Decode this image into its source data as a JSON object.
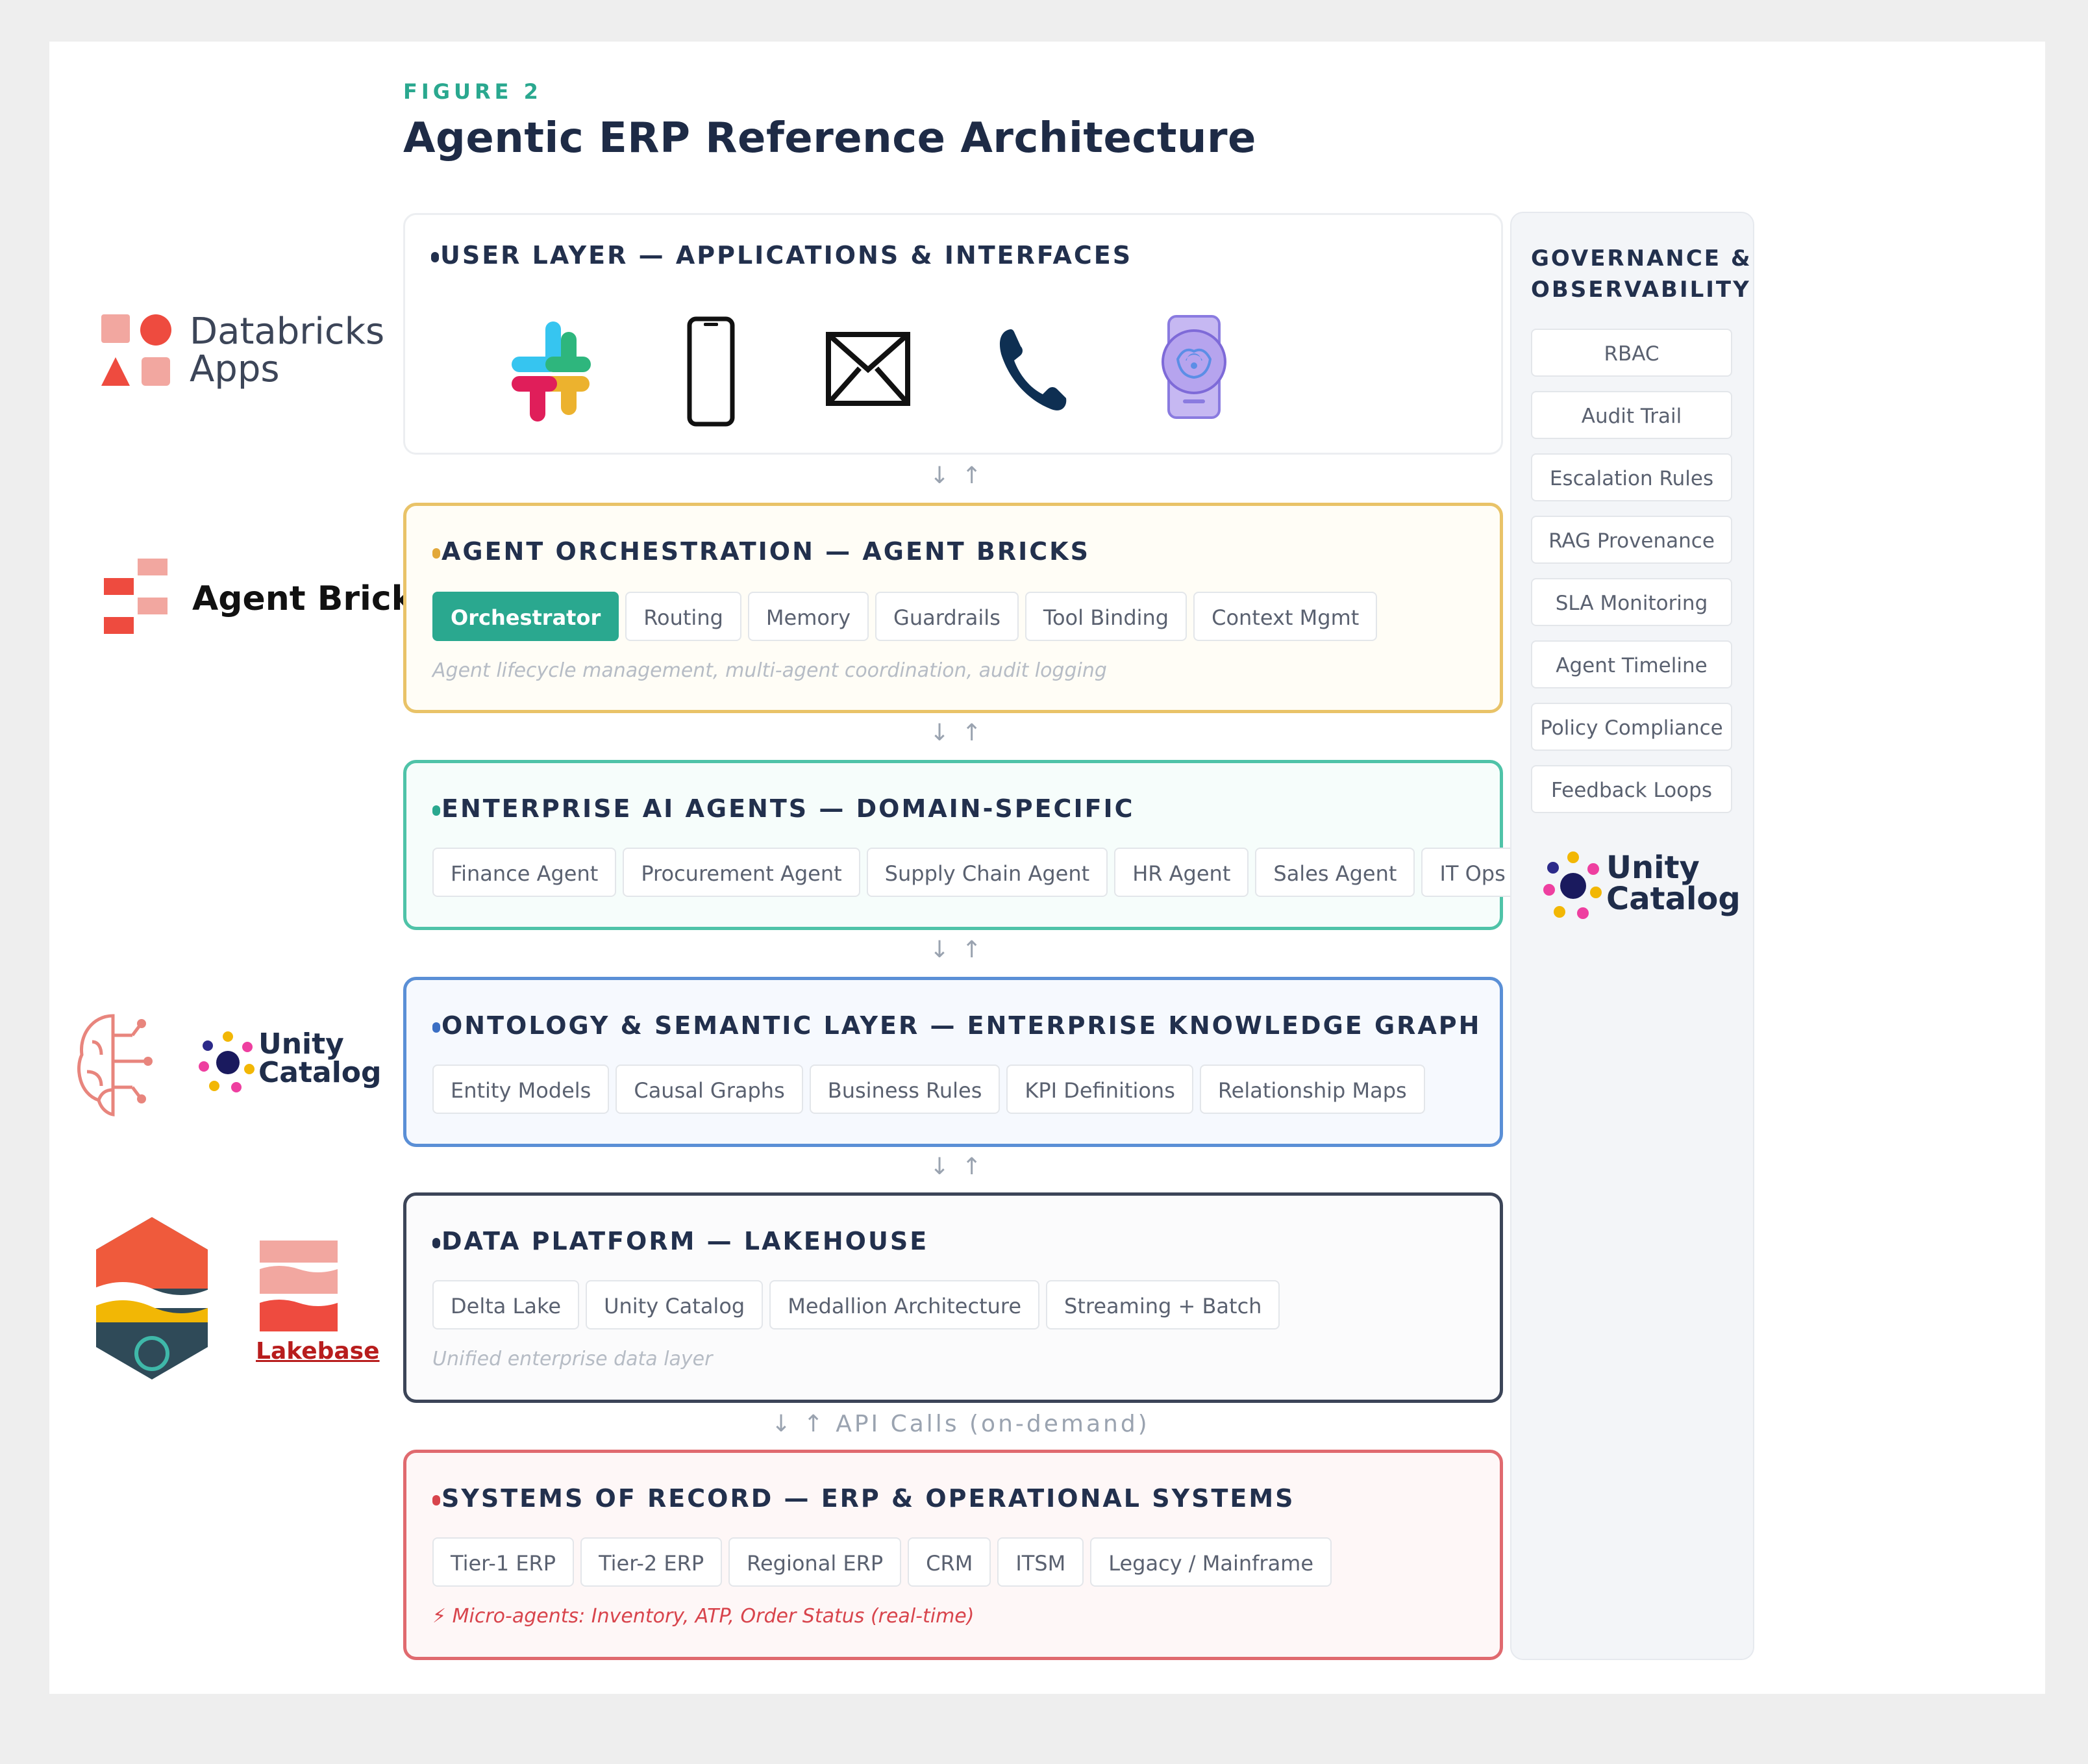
{
  "figure_label": "FIGURE 2",
  "title": "Agentic ERP Reference Architecture",
  "layers": {
    "user": {
      "title": "USER LAYER — APPLICATIONS & INTERFACES",
      "dot_color": "#22304d"
    },
    "orchestration": {
      "title": "AGENT ORCHESTRATION — AGENT BRICKS",
      "dot_color": "#e2a83a",
      "chips": [
        "Orchestrator",
        "Routing",
        "Memory",
        "Guardrails",
        "Tool Binding",
        "Context Mgmt"
      ],
      "active_chip": "Orchestrator",
      "note": "Agent lifecycle management, multi-agent coordination, audit logging"
    },
    "enterprise": {
      "title": "ENTERPRISE AI AGENTS — DOMAIN-SPECIFIC",
      "dot_color": "#2aa88f",
      "chips": [
        "Finance Agent",
        "Procurement Agent",
        "Supply Chain Agent",
        "HR Agent",
        "Sales Agent",
        "IT Ops Agent"
      ]
    },
    "ontology": {
      "title": "ONTOLOGY & SEMANTIC LAYER — ENTERPRISE KNOWLEDGE GRAPH",
      "dot_color": "#3b6fc4",
      "chips": [
        "Entity Models",
        "Causal Graphs",
        "Business Rules",
        "KPI Definitions",
        "Relationship Maps"
      ]
    },
    "data": {
      "title": "DATA PLATFORM — LAKEHOUSE",
      "dot_color": "#22304d",
      "chips": [
        "Delta Lake",
        "Unity Catalog",
        "Medallion Architecture",
        "Streaming + Batch"
      ],
      "note": "Unified enterprise data layer"
    },
    "records": {
      "title": "SYSTEMS OF RECORD — ERP & OPERATIONAL SYSTEMS",
      "dot_color": "#d8444c",
      "chips": [
        "Tier-1 ERP",
        "Tier-2 ERP",
        "Regional ERP",
        "CRM",
        "ITSM",
        "Legacy / Mainframe"
      ],
      "note": "⚡ Micro-agents: Inventory, ATP, Order Status (real-time)"
    }
  },
  "connectors": {
    "default": "↓ ↑",
    "api": "↓ ↑ API Calls (on-demand)"
  },
  "governance": {
    "title_line1": "GOVERNANCE &",
    "title_line2": "OBSERVABILITY",
    "items": [
      "RBAC",
      "Audit Trail",
      "Escalation Rules",
      "RAG Provenance",
      "SLA Monitoring",
      "Agent Timeline",
      "Policy Compliance",
      "Feedback Loops"
    ],
    "logo_line1": "Unity",
    "logo_line2": "Catalog"
  },
  "side_logos": {
    "databricks_line1": "Databricks",
    "databricks_line2": "Apps",
    "agent_bricks": "Agent Bricks",
    "unity_line1": "Unity",
    "unity_line2": "Catalog",
    "lakebase": "Lakebase"
  },
  "colors": {
    "teal": "#2aa88f",
    "navy": "#22304d",
    "orchestration_border": "#e9c368",
    "enterprise_border": "#4fc3a8",
    "ontology_border": "#5a8fd6",
    "data_border": "#3c4558",
    "records_border": "#e06a6f"
  }
}
